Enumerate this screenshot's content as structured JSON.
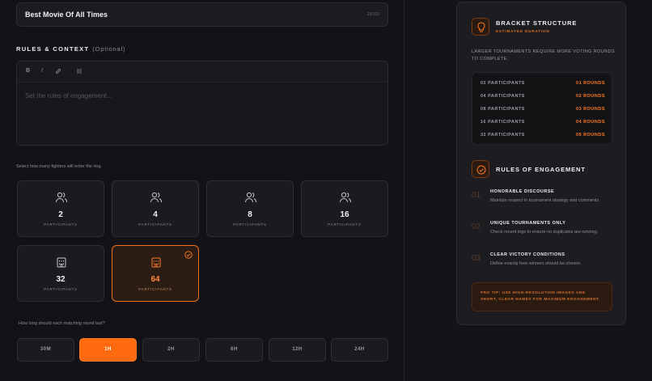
{
  "form": {
    "title_value": "Best Movie Of All Times",
    "title_counter": "23/100",
    "rules_label": "RULES & CONTEXT",
    "rules_optional": "(Optional)",
    "toolbar": {
      "bold": "B",
      "italic": "I",
      "link": "🔗",
      "list": "☰"
    },
    "rules_placeholder": "Set the rules of engagement...",
    "participants_hint": "Select how many fighters will enter the ring.",
    "participants_options": [
      {
        "count": "2",
        "label": "PARTICIPANTS",
        "icon": "users-icon"
      },
      {
        "count": "4",
        "label": "PARTICIPANTS",
        "icon": "users-icon"
      },
      {
        "count": "8",
        "label": "PARTICIPANTS",
        "icon": "users-icon"
      },
      {
        "count": "16",
        "label": "PARTICIPANTS",
        "icon": "users-icon"
      },
      {
        "count": "32",
        "label": "PARTICIPANTS",
        "icon": "building-icon"
      },
      {
        "count": "64",
        "label": "PARTICIPANTS",
        "icon": "building-icon",
        "selected": true
      }
    ],
    "duration_hint": "How long should each matching round last?",
    "durations": [
      {
        "label": "30M"
      },
      {
        "label": "1H",
        "selected": true
      },
      {
        "label": "2H"
      },
      {
        "label": "6H"
      },
      {
        "label": "12H"
      },
      {
        "label": "24H"
      }
    ]
  },
  "sidebar": {
    "bracket": {
      "title": "BRACKET STRUCTURE",
      "subtitle": "ESTIMATED DURATION",
      "description": "LARGER TOURNAMENTS REQUIRE MORE VOTING ROUNDS TO COMPLETE.",
      "rows": [
        {
          "participants": "02 PARTICIPANTS",
          "rounds": "01 ROUNDS"
        },
        {
          "participants": "04 PARTICIPANTS",
          "rounds": "02 ROUNDS"
        },
        {
          "participants": "08 PARTICIPANTS",
          "rounds": "03 ROUNDS"
        },
        {
          "participants": "16 PARTICIPANTS",
          "rounds": "04 ROUNDS"
        },
        {
          "participants": "32 PARTICIPANTS",
          "rounds": "05 ROUNDS"
        }
      ]
    },
    "engagement": {
      "title": "RULES OF ENGAGEMENT",
      "rules": [
        {
          "num": "01",
          "title": "HONORABLE DISCOURSE",
          "desc": "Maintain respect in tournament strategy and comments."
        },
        {
          "num": "02",
          "title": "UNIQUE TOURNAMENTS ONLY",
          "desc": "Check recent logs to ensure no duplicates are running."
        },
        {
          "num": "03",
          "title": "CLEAR VICTORY CONDITIONS",
          "desc": "Define exactly how winners should be chosen."
        }
      ]
    },
    "tip": "PRO TIP: USE HIGH-RESOLUTION IMAGES AND SHORT, CLEAR NAMES FOR MAXIMUM ENGAGEMENT."
  },
  "colors": {
    "accent": "#ff6a0f",
    "background": "#131317",
    "panel": "#1c1c21"
  }
}
